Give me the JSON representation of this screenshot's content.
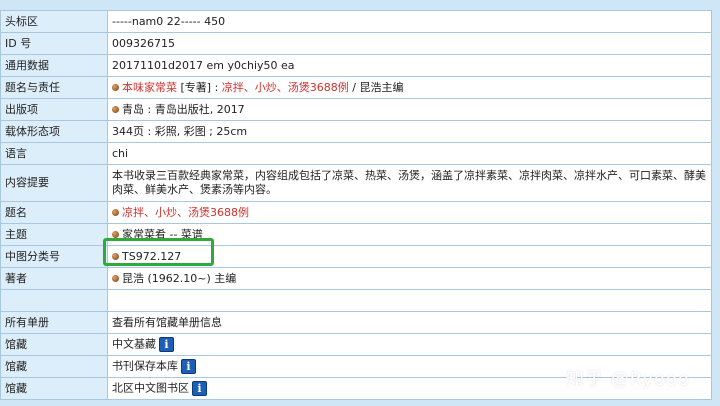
{
  "rows": [
    {
      "label": "头标区",
      "value": "-----nam0 22----- 450"
    },
    {
      "label": "ID 号",
      "value": "009326715"
    },
    {
      "label": "通用数据",
      "value": "20171101d2017 em y0chiy50 ea"
    },
    {
      "label": "题名与责任",
      "link": "本味家常菜",
      "mid": " [专著] : ",
      "red": "凉拌、小炒、汤煲3688例",
      "tail": " / 昆浩主编"
    },
    {
      "label": "出版项",
      "value": "青岛 : 青岛出版社, 2017"
    },
    {
      "label": "载体形态项",
      "value": "344页 : 彩照, 彩图 ; 25cm"
    },
    {
      "label": "语言",
      "value": "chi"
    },
    {
      "label": "内容提要",
      "value": "本书收录三百款经典家常菜，内容组成包括了凉菜、热菜、汤煲，涵盖了凉拌素菜、凉拌肉菜、凉拌水产、可口素菜、酵美肉菜、鲜美水产、煲素汤等内容。"
    },
    {
      "label": "题名",
      "value": "凉拌、小炒、汤煲3688例"
    },
    {
      "label": "主题",
      "value": "家常菜肴 -- 菜谱"
    },
    {
      "label": "中图分类号",
      "value": "TS972.127"
    },
    {
      "label": "著者",
      "value": "昆浩 (1962.10~) 主编"
    },
    {
      "label": "所有单册",
      "value": "查看所有馆藏单册信息"
    },
    {
      "label": "馆藏",
      "value": "中文基藏"
    },
    {
      "label": "馆藏",
      "value": "书刊保存本库"
    },
    {
      "label": "馆藏",
      "value": "北区中文图书区"
    }
  ],
  "icons": {
    "info": "i"
  },
  "watermark": "知乎 @Ryooo",
  "colors": {
    "label_bg": "#dceef9",
    "border": "#a9c8de",
    "link_red": "#d0312d",
    "highlight": "#2faa3a"
  }
}
